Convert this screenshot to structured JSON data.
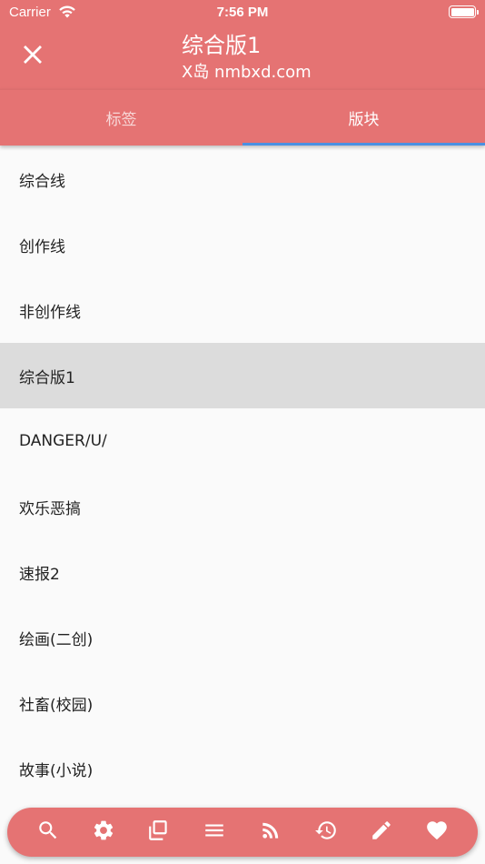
{
  "status_bar": {
    "carrier": "Carrier",
    "time": "7:56 PM"
  },
  "app_bar": {
    "title": "综合版1",
    "subtitle": "X岛 nmbxd.com",
    "close_icon": "close-icon"
  },
  "tabs": [
    {
      "label": "标签",
      "active": false
    },
    {
      "label": "版块",
      "active": true
    }
  ],
  "forums": [
    {
      "label": "综合线",
      "selected": false
    },
    {
      "label": "创作线",
      "selected": false
    },
    {
      "label": "非创作线",
      "selected": false
    },
    {
      "label": "综合版1",
      "selected": true
    },
    {
      "label": "DANGER/U/",
      "selected": false
    },
    {
      "label": "欢乐恶搞",
      "selected": false
    },
    {
      "label": "速报2",
      "selected": false
    },
    {
      "label": "绘画(二创)",
      "selected": false
    },
    {
      "label": "社畜(校园)",
      "selected": false
    },
    {
      "label": "故事(小说)",
      "selected": false
    }
  ],
  "bottom_bar": {
    "icons": [
      "search-icon",
      "gear-icon",
      "copy-icon",
      "menu-icon",
      "rss-icon",
      "history-icon",
      "edit-icon",
      "heart-icon"
    ]
  },
  "colors": {
    "accent": "#e57373",
    "tab_indicator": "#4a90e2",
    "selected_row": "#dcdcdc"
  }
}
